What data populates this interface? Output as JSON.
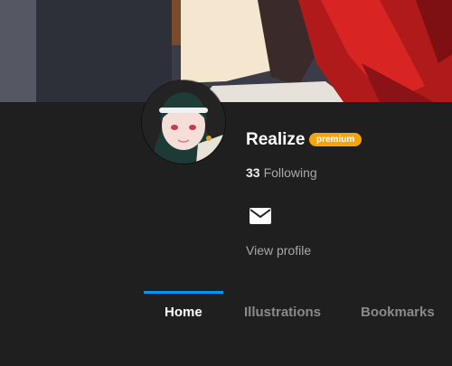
{
  "profile": {
    "name": "Realize",
    "badge": "premium",
    "following_count": "33",
    "following_label": "Following",
    "view_profile_label": "View profile"
  },
  "icons": {
    "message": "mail-icon"
  },
  "tabs": [
    {
      "label": "Home",
      "active": true
    },
    {
      "label": "Illustrations",
      "active": false
    },
    {
      "label": "Bookmarks",
      "active": false
    }
  ],
  "colors": {
    "background": "#1f1f1f",
    "accent_blue": "#0096fa",
    "premium_badge": "#f6a40b"
  }
}
